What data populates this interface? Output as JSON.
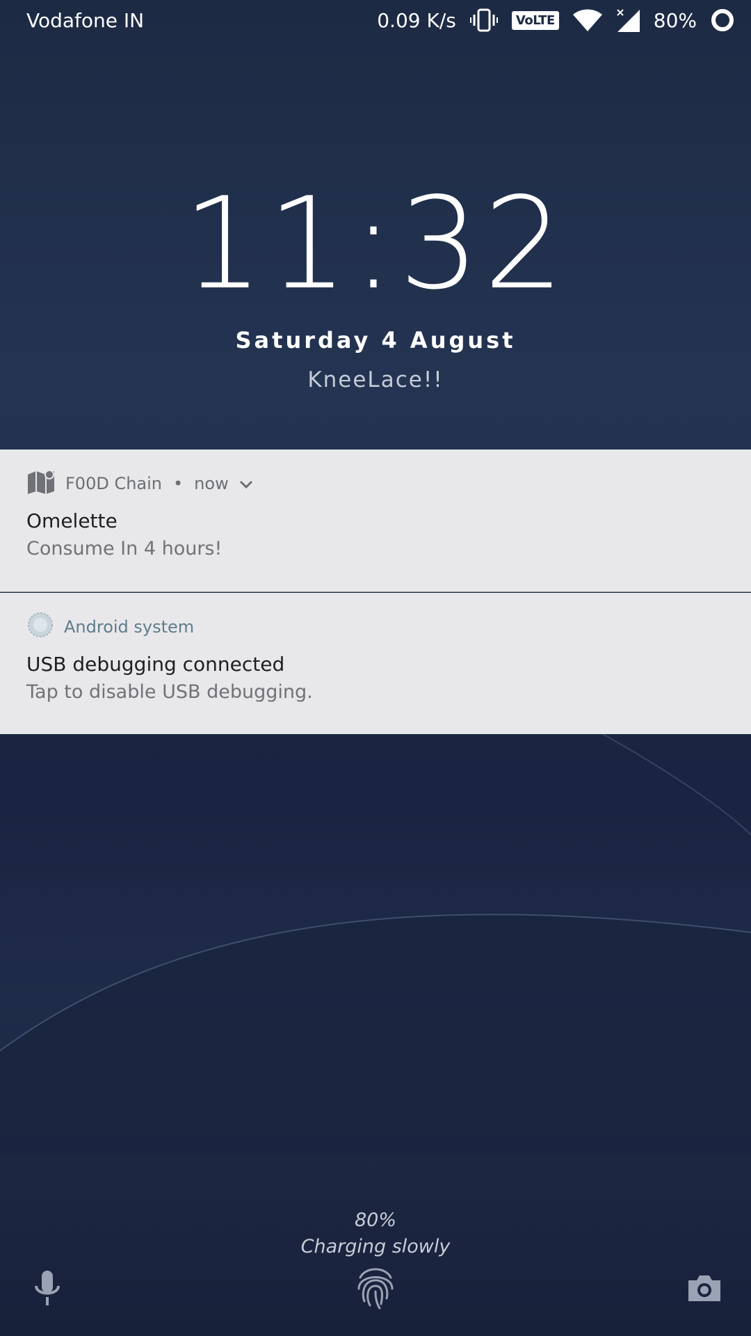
{
  "status_bar": {
    "carrier": "Vodafone IN",
    "network_speed": "0.09 K/s",
    "volte": "VoLTE",
    "battery": "80%",
    "icons": [
      "vibrate-icon",
      "volte-icon",
      "wifi-icon",
      "signal-icon",
      "battery-icon"
    ]
  },
  "lockscreen": {
    "time": "11:32",
    "date": "Saturday 4 August",
    "owner_info": "KneeLace!!"
  },
  "notifications": [
    {
      "app": "F00D Chain",
      "separator": "•",
      "time": "now",
      "title": "Omelette",
      "text": "Consume In 4 hours!",
      "icon": "map-icon"
    },
    {
      "app": "Android system",
      "title": "USB debugging connected",
      "text": "Tap to disable USB debugging.",
      "icon": "android-system-icon"
    }
  ],
  "charging": {
    "level": "80%",
    "status": "Charging slowly"
  },
  "bottom_icons": [
    "mic-icon",
    "fingerprint-icon",
    "camera-icon"
  ],
  "colors": {
    "background": "#1d2a44",
    "notification_bg": "#e8e8eb",
    "android_app_accent": "#5f7c8c"
  }
}
